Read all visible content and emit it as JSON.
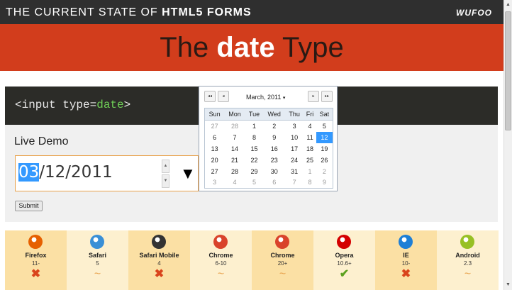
{
  "header": {
    "title_prefix": "THE CURRENT STATE OF ",
    "title_bold": "HTML5 FORMS",
    "logo": "WUFOO"
  },
  "hero": {
    "title_before": "The ",
    "title_bold": "date",
    "title_after": " Type"
  },
  "code": {
    "before": "<input type=",
    "value": "date",
    "after": ">"
  },
  "demo": {
    "label": "Live Demo",
    "date_selected": "03",
    "date_rest": "/12/2011",
    "dropdown_glyph": "▼",
    "submit_label": "Submit"
  },
  "calendar": {
    "month_label": "March, 2011",
    "caret": "▾",
    "nav": {
      "prev_year": "◂◂",
      "prev_month": "◂",
      "next_month": "▸",
      "next_year": "▸▸"
    },
    "weekdays": [
      "Sun",
      "Mon",
      "Tue",
      "Wed",
      "Thu",
      "Fri",
      "Sat"
    ],
    "weeks": [
      [
        {
          "d": "27",
          "other": true
        },
        {
          "d": "28",
          "other": true
        },
        {
          "d": "1"
        },
        {
          "d": "2"
        },
        {
          "d": "3"
        },
        {
          "d": "4"
        },
        {
          "d": "5"
        }
      ],
      [
        {
          "d": "6"
        },
        {
          "d": "7"
        },
        {
          "d": "8"
        },
        {
          "d": "9"
        },
        {
          "d": "10"
        },
        {
          "d": "11"
        },
        {
          "d": "12",
          "today": true
        }
      ],
      [
        {
          "d": "13"
        },
        {
          "d": "14"
        },
        {
          "d": "15"
        },
        {
          "d": "16"
        },
        {
          "d": "17"
        },
        {
          "d": "18"
        },
        {
          "d": "19"
        }
      ],
      [
        {
          "d": "20"
        },
        {
          "d": "21"
        },
        {
          "d": "22"
        },
        {
          "d": "23"
        },
        {
          "d": "24"
        },
        {
          "d": "25"
        },
        {
          "d": "26"
        }
      ],
      [
        {
          "d": "27"
        },
        {
          "d": "28"
        },
        {
          "d": "29"
        },
        {
          "d": "30"
        },
        {
          "d": "31"
        },
        {
          "d": "1",
          "other": true
        },
        {
          "d": "2",
          "other": true
        }
      ],
      [
        {
          "d": "3",
          "other": true
        },
        {
          "d": "4",
          "other": true
        },
        {
          "d": "5",
          "other": true
        },
        {
          "d": "6",
          "other": true
        },
        {
          "d": "7",
          "other": true
        },
        {
          "d": "8",
          "other": true
        },
        {
          "d": "9",
          "other": true
        }
      ]
    ]
  },
  "browsers": [
    {
      "name": "Firefox",
      "version": "11-",
      "status": "no",
      "icon": "firefox-icon",
      "color": "#e66000"
    },
    {
      "name": "Safari",
      "version": "5",
      "status": "partial",
      "icon": "safari-icon",
      "color": "#3a8fd6"
    },
    {
      "name": "Safari Mobile",
      "version": "4",
      "status": "no",
      "icon": "safari-mobile-icon",
      "color": "#333333"
    },
    {
      "name": "Chrome",
      "version": "6-10",
      "status": "partial",
      "icon": "chrome-icon",
      "color": "#d9432b"
    },
    {
      "name": "Chrome",
      "version": "20+",
      "status": "partial",
      "icon": "chrome-icon",
      "color": "#d9432b"
    },
    {
      "name": "Opera",
      "version": "10.6+",
      "status": "yes",
      "icon": "opera-icon",
      "color": "#d40000"
    },
    {
      "name": "IE",
      "version": "10-",
      "status": "no",
      "icon": "ie-icon",
      "color": "#1e7fd6"
    },
    {
      "name": "Android",
      "version": "2.3",
      "status": "partial",
      "icon": "android-icon",
      "color": "#97c024"
    }
  ],
  "status_glyphs": {
    "no": "✖",
    "partial": "~",
    "yes": "✔"
  }
}
